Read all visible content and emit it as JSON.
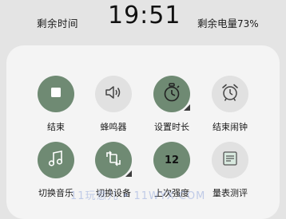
{
  "topbar": {
    "remaining_time_label": "剩余时间",
    "clock": "19:51",
    "battery_label": "剩余电量",
    "battery_percent": "73%"
  },
  "controls": [
    {
      "label": "结束",
      "icon": "stop-icon"
    },
    {
      "label": "蜂鸣器",
      "icon": "speaker-icon"
    },
    {
      "label": "设置时长",
      "icon": "timer-icon"
    },
    {
      "label": "结束闹钟",
      "icon": "alarm-clock-icon"
    },
    {
      "label": "切换音乐",
      "icon": "music-note-icon"
    },
    {
      "label": "切换设备",
      "icon": "switch-device-icon"
    },
    {
      "label": "上次强度",
      "icon": "intensity-number",
      "value": "12"
    },
    {
      "label": "量表测评",
      "icon": "document-icon"
    }
  ],
  "watermark": "11玩意儿 • 11WYX.COM",
  "colors": {
    "accent": "#6f8a73",
    "light_button": "#e1e1e1",
    "panel": "#f4f4f4",
    "background": "#e4e4e4"
  }
}
